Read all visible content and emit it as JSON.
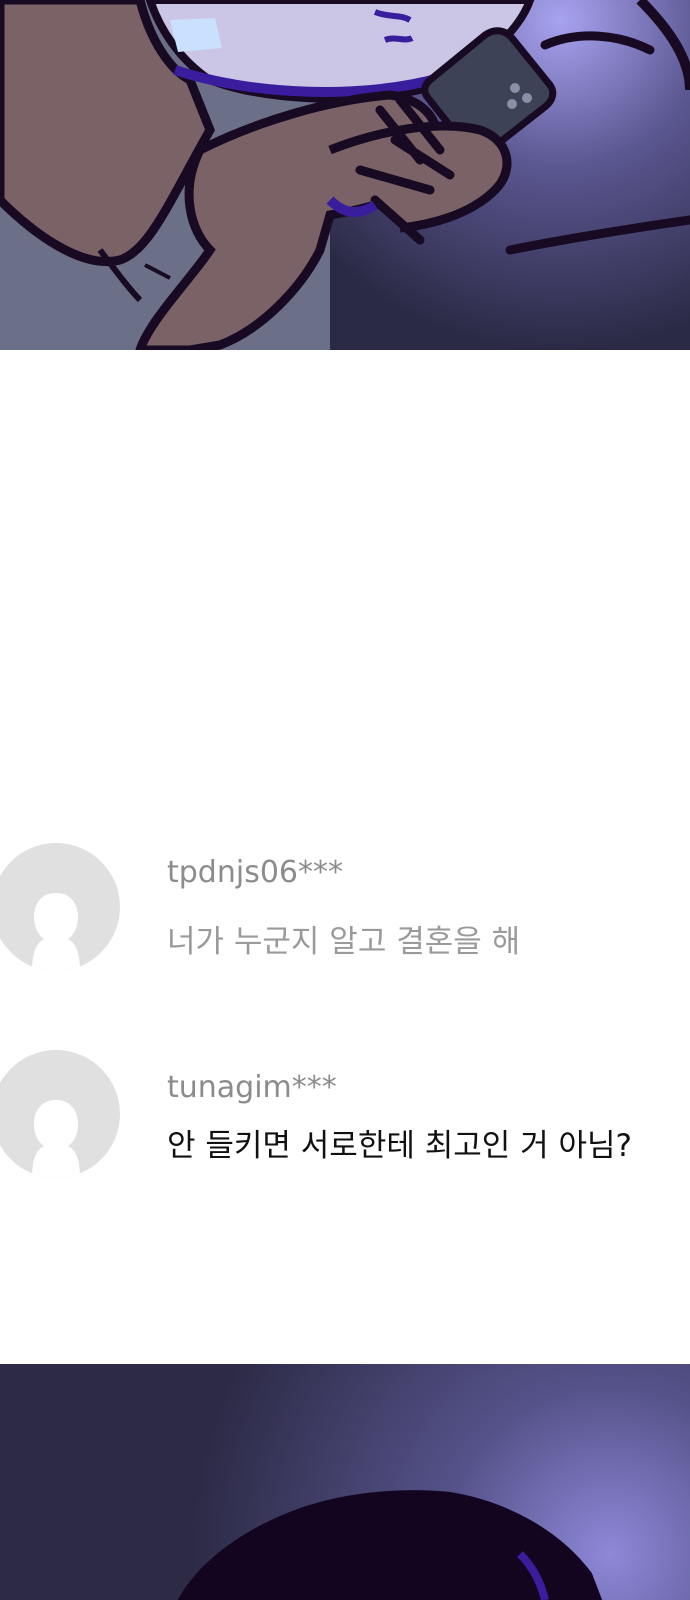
{
  "comments": [
    {
      "username": "tpdnjs06***",
      "text": "너가 누군지 알고 결혼을 해",
      "text_style": "muted"
    },
    {
      "username": "tunagim***",
      "text": "안 들키면 서로한테 최고인 거 아님?",
      "text_style": "emphasis"
    }
  ],
  "colors": {
    "background": "#ffffff",
    "avatar_bg": "#e0e0e0",
    "avatar_silhouette": "#ffffff",
    "username": "#8c8c8c",
    "muted_text": "#9a9a9a",
    "emphasis_text": "#111111",
    "panel_dark": "#2d2b45",
    "panel_purple": "#8b86d4",
    "skin": "#7a6266",
    "ink": "#170a22"
  },
  "icons": {
    "avatar": "default-user-silhouette-icon"
  }
}
